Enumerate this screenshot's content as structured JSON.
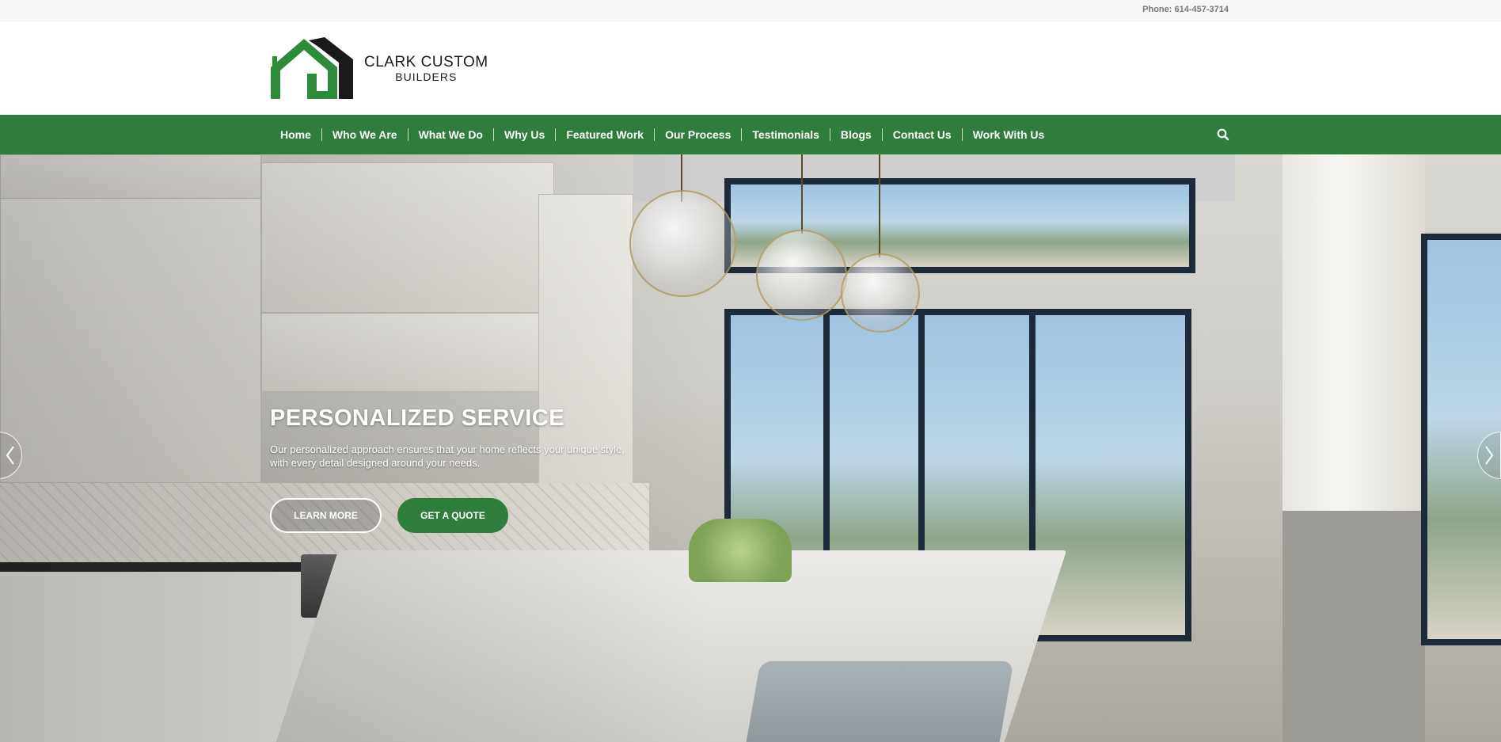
{
  "topbar": {
    "phone": "Phone: 614-457-3714"
  },
  "logo": {
    "line1": "CLARK CUSTOM",
    "line2": "BUILDERS",
    "icon": "house-logo-icon"
  },
  "nav": {
    "items": [
      {
        "label": "Home"
      },
      {
        "label": "Who We Are"
      },
      {
        "label": "What We Do"
      },
      {
        "label": "Why Us"
      },
      {
        "label": "Featured Work"
      },
      {
        "label": "Our Process"
      },
      {
        "label": "Testimonials"
      },
      {
        "label": "Blogs"
      },
      {
        "label": "Contact Us"
      },
      {
        "label": "Work With Us"
      }
    ],
    "search_icon": "search-icon"
  },
  "hero": {
    "title": "PERSONALIZED SERVICE",
    "text": "Our personalized approach ensures that your home reflects your unique style, with every detail designed around your needs.",
    "learn_more": "LEARN MORE",
    "get_quote": "GET A QUOTE",
    "prev_icon": "chevron-left-icon",
    "next_icon": "chevron-right-icon"
  },
  "colors": {
    "brand_green": "#2e7d3a",
    "topbar_bg": "#f7f7f7",
    "logo_dark": "#1a1a1a"
  }
}
